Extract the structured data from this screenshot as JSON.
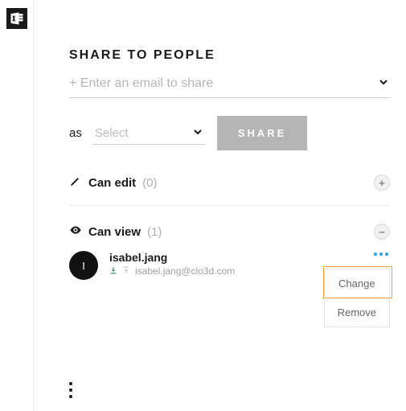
{
  "header": {
    "title": "SHARE TO PEOPLE"
  },
  "email_input": {
    "placeholder": "+ Enter an email to share"
  },
  "role_select": {
    "as_label": "as",
    "placeholder": "Select"
  },
  "share_button": {
    "label": "SHARE"
  },
  "sections": {
    "can_edit": {
      "label": "Can edit",
      "count": "(0)"
    },
    "can_view": {
      "label": "Can view",
      "count": "(1)"
    }
  },
  "viewers": [
    {
      "initial": "I",
      "name": "isabel.jang",
      "email": "isabel.jang@clo3d.com"
    }
  ],
  "context_menu": {
    "change": "Change",
    "remove": "Remove"
  }
}
